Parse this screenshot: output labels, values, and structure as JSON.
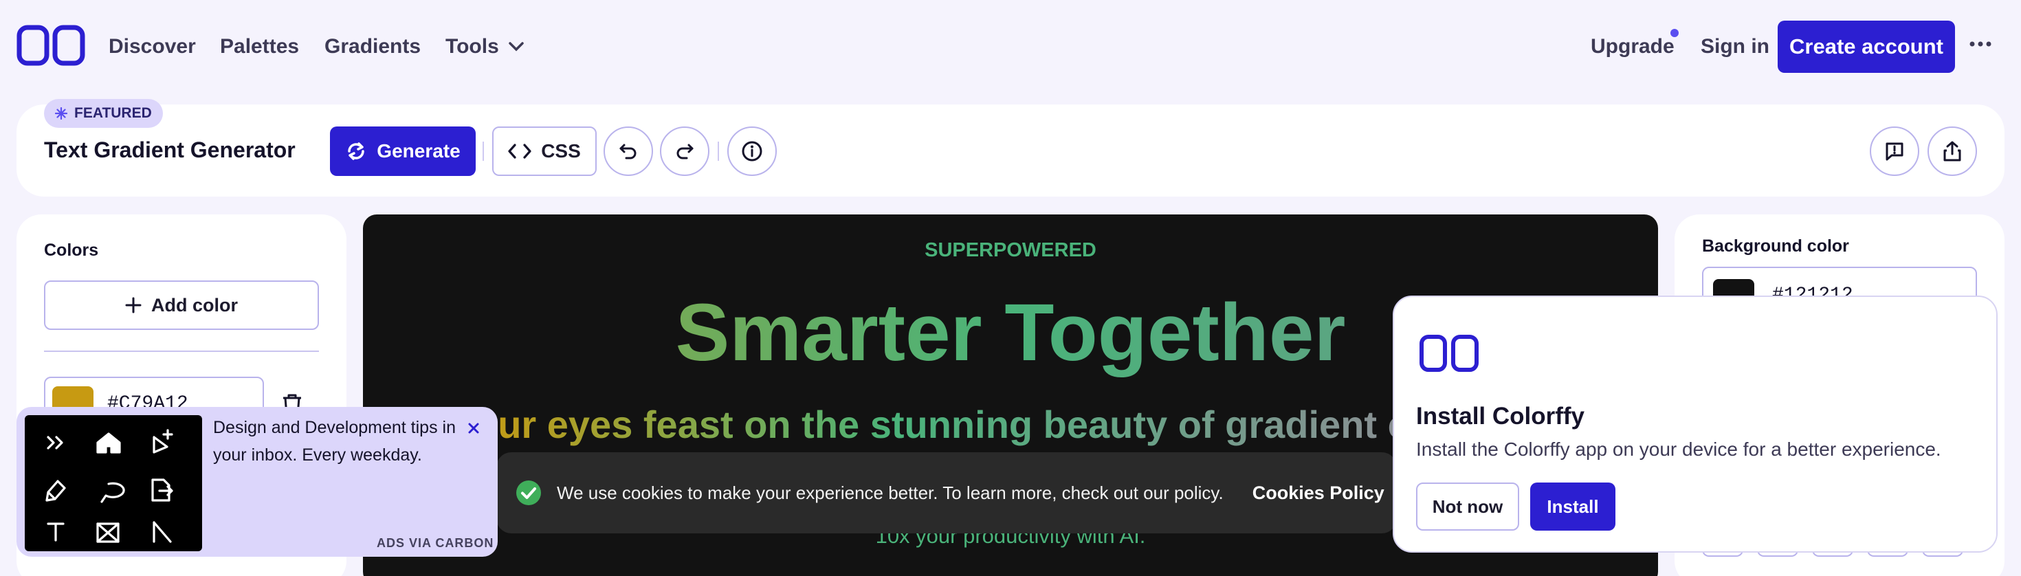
{
  "brand": {
    "accent": "#2c1fd1",
    "accent_soft": "#dcd6fb"
  },
  "nav": {
    "links": [
      "Discover",
      "Palettes",
      "Gradients",
      "Tools"
    ],
    "upgrade": "Upgrade",
    "signin": "Sign in",
    "create_account": "Create account"
  },
  "toolbar": {
    "badge": "FEATURED",
    "title": "Text Gradient Generator",
    "generate": "Generate",
    "css": "CSS"
  },
  "colors_panel": {
    "label": "Colors",
    "add_color": "Add color",
    "items": [
      {
        "hex": "#C79A12",
        "swatch": "#c79a12"
      }
    ]
  },
  "preview": {
    "kicker": "SUPERPOWERED",
    "headline": "Smarter Together",
    "subline": "our eyes feast on the stunning beauty of gradient c",
    "tagline": "10x your productivity with AI."
  },
  "background_panel": {
    "label": "Background color",
    "hex": "#121212",
    "swatch": "#121212"
  },
  "cookie": {
    "text": "We use cookies to make your experience better. To learn more, check out our policy.",
    "link": "Cookies Policy"
  },
  "ad": {
    "text": "Design and Development tips in your inbox. Every weekday.",
    "via": "ADS VIA CARBON"
  },
  "install": {
    "title": "Install Colorffy",
    "description": "Install the Colorffy app on your device for a better experience.",
    "not_now": "Not now",
    "install": "Install"
  }
}
